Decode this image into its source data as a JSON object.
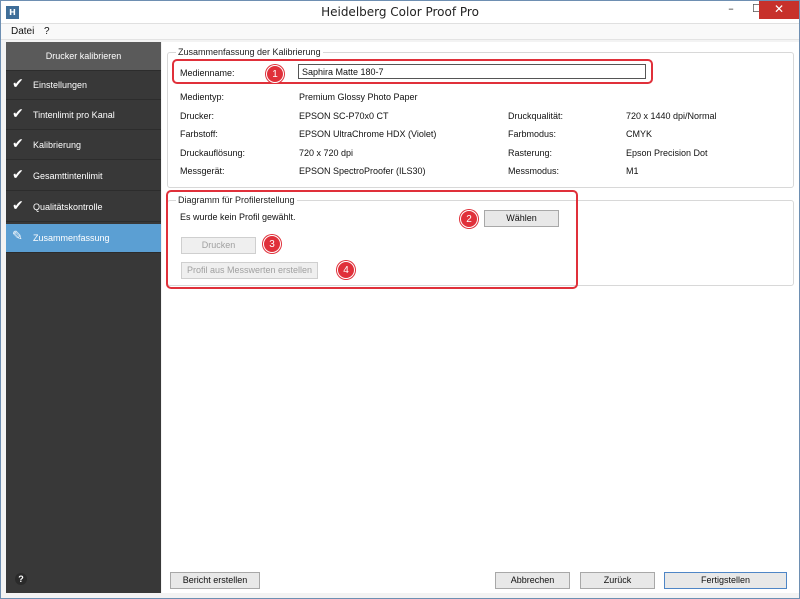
{
  "window": {
    "title": "Heidelberg Color Proof Pro",
    "app_icon": "H",
    "minimize": "–",
    "maximize": "☐",
    "close": "✕"
  },
  "menu": [
    "Datei",
    "?"
  ],
  "sidebar": {
    "items": [
      {
        "label": "Drucker kalibrieren",
        "checked": false
      },
      {
        "label": "Einstellungen",
        "checked": true
      },
      {
        "label": "Tintenlimit pro Kanal",
        "checked": true
      },
      {
        "label": "Kalibrierung",
        "checked": true
      },
      {
        "label": "Gesamttintenlimit",
        "checked": true
      },
      {
        "label": "Qualitätskontrolle",
        "checked": true
      },
      {
        "label": "Zusammenfassung",
        "checked": false,
        "active": true
      }
    ],
    "check_glyph": "✔",
    "edit_glyph": "✎",
    "help_glyph": "?"
  },
  "summary": {
    "title": "Zusammenfassung der Kalibrierung",
    "medienname_label": "Medienname:",
    "medienname_value": "Saphira Matte 180-7",
    "medientyp_label": "Medientyp:",
    "medientyp_value": "Premium Glossy Photo Paper",
    "drucker_label": "Drucker:",
    "drucker_value": "EPSON SC-P70x0 CT",
    "farbstoff_label": "Farbstoff:",
    "farbstoff_value": "EPSON UltraChrome HDX (Violet)",
    "druckaufloesung_label": "Druckauflösung:",
    "druckaufloesung_value": "720 x 720 dpi",
    "messgeraet_label": "Messgerät:",
    "messgeraet_value": "EPSON SpectroProofer (ILS30)",
    "druckqualitaet_label": "Druckqualität:",
    "druckqualitaet_value": "720 x 1440 dpi/Normal",
    "farbmodus_label": "Farbmodus:",
    "farbmodus_value": "CMYK",
    "rasterung_label": "Rasterung:",
    "rasterung_value": "Epson Precision Dot",
    "messmodus_label": "Messmodus:",
    "messmodus_value": "M1"
  },
  "profile": {
    "title": "Diagramm für Profilerstellung",
    "status": "Es wurde kein Profil gewählt.",
    "choose_button": "Wählen",
    "print_button": "Drucken",
    "create_button": "Profil aus Messwerten erstellen"
  },
  "badges": [
    "1",
    "2",
    "3",
    "4"
  ],
  "footer": {
    "report_button": "Bericht erstellen",
    "cancel_button": "Abbrechen",
    "back_button": "Zurück",
    "finish_button": "Fertigstellen"
  },
  "colors": {
    "sidebar_bg": "#383838",
    "sidebar_active": "#5b9fd3",
    "annotation_red": "#e0303a",
    "close_button": "#c7312b"
  }
}
